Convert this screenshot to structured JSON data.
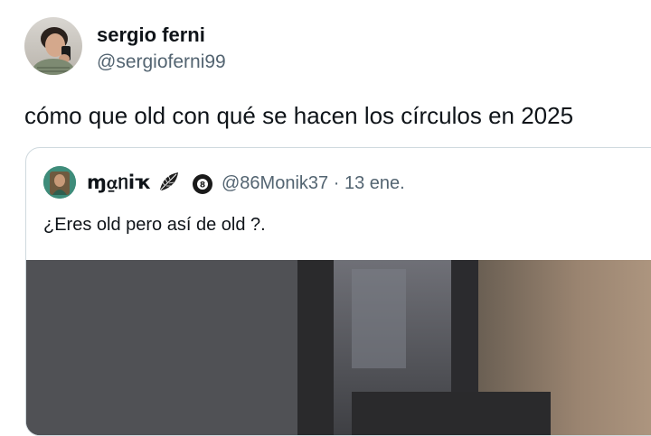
{
  "tweet": {
    "author": {
      "name": "sergio ferni",
      "handle": "@sergioferni99",
      "avatar_icon": "profile-photo"
    },
    "text": "cómo que old con qué se hacen los círculos en 2025"
  },
  "quoted_tweet": {
    "author": {
      "name": "ɱ⍶ᥒiҡ",
      "emoji_icon": "leaf-icon",
      "badge": "8",
      "badge_icon": "eight-ball-icon",
      "handle": "@86Monik37",
      "separator": "·",
      "date": "13 ene."
    },
    "text": "¿Eres old pero así de old ?.",
    "media_icon": "photo-attachment"
  },
  "colors": {
    "text_primary": "#0f1419",
    "text_secondary": "#536471",
    "border": "#cfd9de"
  }
}
